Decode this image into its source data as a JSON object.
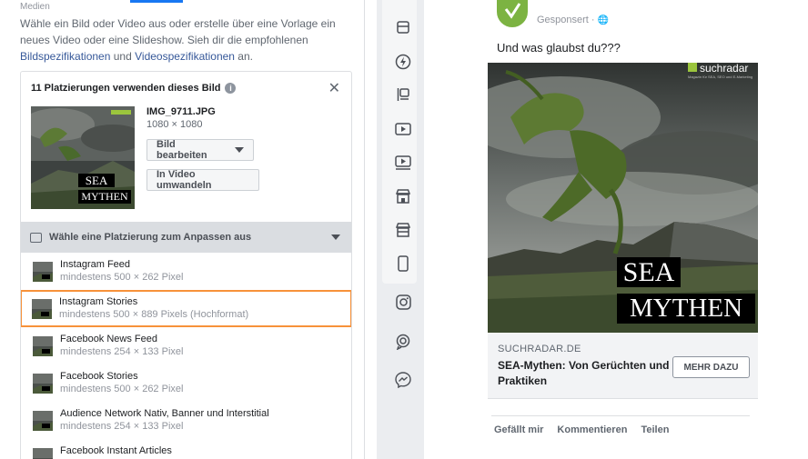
{
  "left": {
    "section_label": "Medien",
    "intro_text": "Wähle ein Bild oder Video aus oder erstelle über eine Vorlage ein neues Video oder eine Slideshow. Sieh dir die empfohlenen ",
    "intro_link1": "Bildspezifikationen",
    "intro_and": " und ",
    "intro_link2": "Videospezifikationen",
    "intro_end": " an.",
    "card_title": "11 Platzierungen verwenden dieses Bild",
    "file_name": "IMG_9711.JPG",
    "file_dims": "1080 × 1080",
    "edit_button": "Bild bearbeiten",
    "video_button": "In Video umwandeln",
    "dropdown_label": "Wähle eine Platzierung zum Anpassen aus",
    "placements": [
      {
        "title": "Instagram Feed",
        "sub": "mindestens 500 × 262 Pixel"
      },
      {
        "title": "Instagram Stories",
        "sub": "mindestens 500 × 889 Pixels (Hochformat)"
      },
      {
        "title": "Facebook News Feed",
        "sub": "mindestens 254 × 133 Pixel"
      },
      {
        "title": "Facebook Stories",
        "sub": "mindestens 500 × 262 Pixel"
      },
      {
        "title": "Audience Network Nativ, Banner und Interstitial",
        "sub": "mindestens 254 × 133 Pixel"
      },
      {
        "title": "Facebook Instant Articles",
        "sub": ""
      }
    ],
    "selected_placement": 1
  },
  "thumb_text": {
    "line1": "SEA",
    "line2": "MYTHEN"
  },
  "rail_icons": [
    "feed-icon",
    "lightning-icon",
    "instream-icon",
    "video-icon",
    "video-play-icon",
    "marketplace-icon",
    "shop-icon",
    "phone-icon",
    "instagram-icon",
    "search-chat-icon",
    "messenger-icon"
  ],
  "preview": {
    "sponsored": "Gesponsert ·",
    "post_text": "Und was glaubst du???",
    "brand_logo": "suchradar",
    "brand_tagline": "Magazin für SEA, SEO und E-Marketing",
    "image_line1": "SEA",
    "image_line2": "MYTHEN",
    "domain": "SUCHRADAR.DE",
    "headline": "SEA-Mythen: Von Gerüchten und Praktiken",
    "cta": "MEHR DAZU",
    "actions": [
      "Gefällt mir",
      "Kommentieren",
      "Teilen"
    ]
  },
  "colors": {
    "accent": "#1877f2",
    "selected_outline": "#f7923a",
    "link": "#365899"
  }
}
